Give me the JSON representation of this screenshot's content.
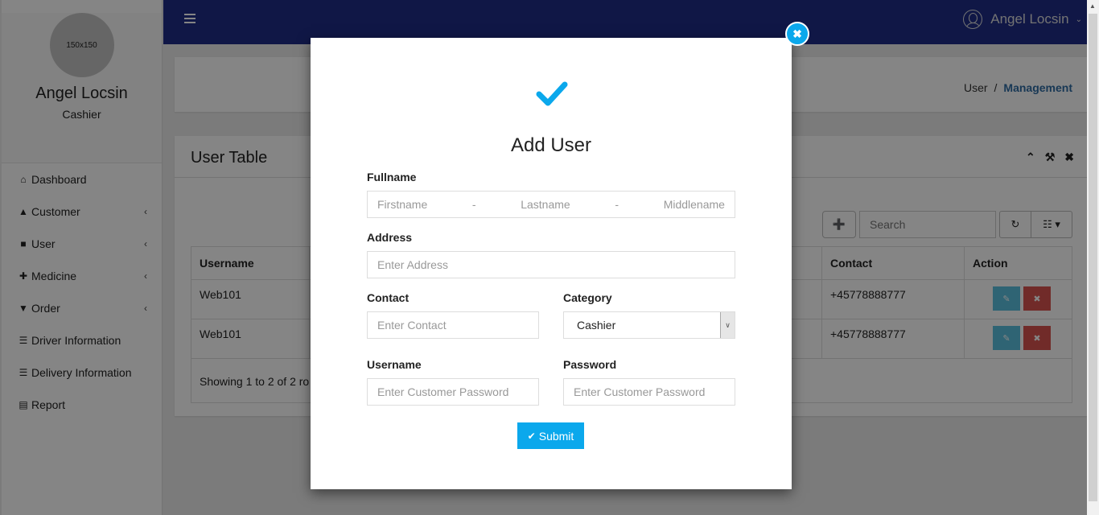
{
  "sidebar": {
    "avatar_text": "150x150",
    "name": "Angel Locsin",
    "role": "Cashier",
    "items": [
      {
        "label": "Dashboard",
        "icon": "home-icon",
        "glyph": "⌂",
        "chevron": ""
      },
      {
        "label": "Customer",
        "icon": "user-icon",
        "glyph": "▲",
        "chevron": "‹"
      },
      {
        "label": "User",
        "icon": "user-secret-icon",
        "glyph": "■",
        "chevron": "‹"
      },
      {
        "label": "Medicine",
        "icon": "medkit-icon",
        "glyph": "✚",
        "chevron": "‹"
      },
      {
        "label": "Order",
        "icon": "cart-icon",
        "glyph": "▼",
        "chevron": "‹"
      },
      {
        "label": "Driver Information",
        "icon": "list-alt-icon",
        "glyph": "☰",
        "chevron": ""
      },
      {
        "label": "Delivery Information",
        "icon": "list-alt-icon",
        "glyph": "☰",
        "chevron": ""
      },
      {
        "label": "Report",
        "icon": "newspaper-icon",
        "glyph": "▤",
        "chevron": ""
      }
    ]
  },
  "topbar": {
    "user_name": "Angel Locsin",
    "chevron": "⌄"
  },
  "breadcrumb": {
    "parent": "User",
    "separator": "/",
    "current": "Management"
  },
  "table_panel": {
    "title": "User Table",
    "tools": {
      "collapse": "⌃",
      "settings": "⚒",
      "close": "✖"
    },
    "search_placeholder": "Search",
    "add_glyph": "➕",
    "refresh_glyph": "↻",
    "columns_glyph": "☷ ▾",
    "columns": [
      "Username",
      "Contact",
      "Action"
    ],
    "rows": [
      {
        "username": "Web101",
        "contact": "+45778888777"
      },
      {
        "username": "Web101",
        "contact": "+45778888777"
      }
    ],
    "footer": "Showing 1 to 2 of 2 ro",
    "edit_glyph": "✎",
    "delete_glyph": "✖"
  },
  "modal": {
    "title": "Add User",
    "close_glyph": "✖",
    "fullname_label": "Fullname",
    "firstname_placeholder": "Firstname",
    "lastname_placeholder": "Lastname",
    "middlename_placeholder": "Middlename",
    "name_separator": "-",
    "address_label": "Address",
    "address_placeholder": "Enter Address",
    "contact_label": "Contact",
    "contact_placeholder": "Enter Contact",
    "category_label": "Category",
    "category_value": "Cashier",
    "category_arrow": "∨",
    "username_label": "Username",
    "username_placeholder": "Enter Customer Password",
    "password_label": "Password",
    "password_placeholder": "Enter Customer Password",
    "submit_label": "Submit",
    "submit_glyph": "✔"
  },
  "colors": {
    "topbar": "#1f2d87",
    "accent": "#0ba8ec",
    "breadcrumb_active": "#2f6ca3",
    "edit_button": "#5bc0de",
    "delete_button": "#d9534f"
  }
}
